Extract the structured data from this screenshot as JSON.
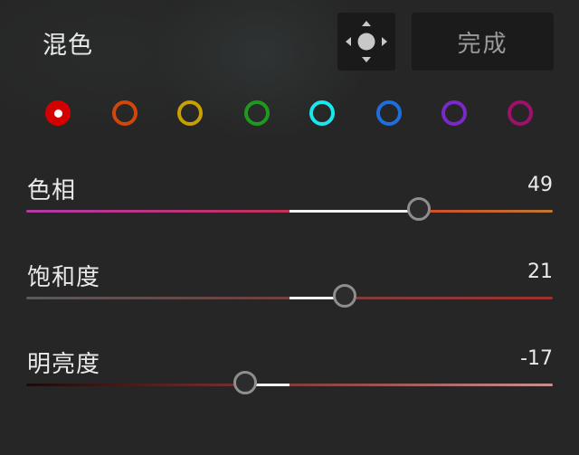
{
  "header": {
    "title": "混色",
    "move_icon": "move-arrows-icon",
    "done_label": "完成"
  },
  "swatches": [
    {
      "name": "red",
      "color": "#d40000",
      "active": true
    },
    {
      "name": "orange",
      "color": "#d2450b",
      "active": false
    },
    {
      "name": "yellow",
      "color": "#c8a000",
      "active": false
    },
    {
      "name": "green",
      "color": "#1f9a1f",
      "active": false
    },
    {
      "name": "aqua",
      "color": "#18e8ee",
      "active": false
    },
    {
      "name": "blue",
      "color": "#1e6ee0",
      "active": false
    },
    {
      "name": "purple",
      "color": "#7a28c8",
      "active": false
    },
    {
      "name": "magenta",
      "color": "#a0106a",
      "active": false
    }
  ],
  "sliders": [
    {
      "id": "hue",
      "label": "色相",
      "value": "49",
      "numeric": 49,
      "min": -100,
      "max": 100,
      "track_gradient": "linear-gradient(to right, #b03aa8 0%, #c0305a 48%, #d04a2a 72%, #c07830 100%)"
    },
    {
      "id": "saturation",
      "label": "饱和度",
      "value": "21",
      "numeric": 21,
      "min": -100,
      "max": 100,
      "track_gradient": "linear-gradient(to right, #5a5a5a 0%, #6a4444 40%, #a03030 100%)"
    },
    {
      "id": "luminance",
      "label": "明亮度",
      "value": "-17",
      "numeric": -17,
      "min": -100,
      "max": 100,
      "track_gradient": "linear-gradient(to right, #1a0a0a 0%, #6a2a2a 35%, #9a5050 65%, #c89090 100%)"
    }
  ]
}
